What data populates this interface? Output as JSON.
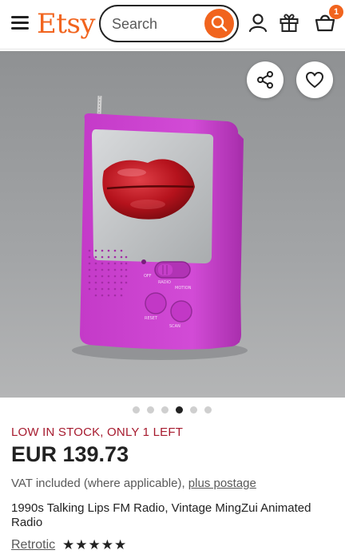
{
  "header": {
    "logo": "Etsy",
    "search_placeholder": "Search",
    "cart_count": "1",
    "brand_color": "#f1641e"
  },
  "icons": [
    "menu-icon",
    "search-icon",
    "account-icon",
    "gift-icon",
    "cart-icon",
    "share-icon",
    "heart-icon"
  ],
  "carousel": {
    "total": 6,
    "active": 3
  },
  "listing": {
    "stock_notice": "LOW IN STOCK, ONLY 1 LEFT",
    "price": "EUR 139.73",
    "vat_text": "VAT included (where applicable), ",
    "postage_link": "plus postage",
    "title": "1990s Talking Lips FM Radio, Vintage MingZui Animated Radio",
    "shop_name": "Retrotic",
    "rating_stars": "★★★★★",
    "rating": 5
  },
  "image": {
    "radio_labels": {
      "off": "OFF",
      "radio": "RADIO",
      "motion": "MOTION",
      "reset": "RESET",
      "scan": "SCAN"
    }
  }
}
